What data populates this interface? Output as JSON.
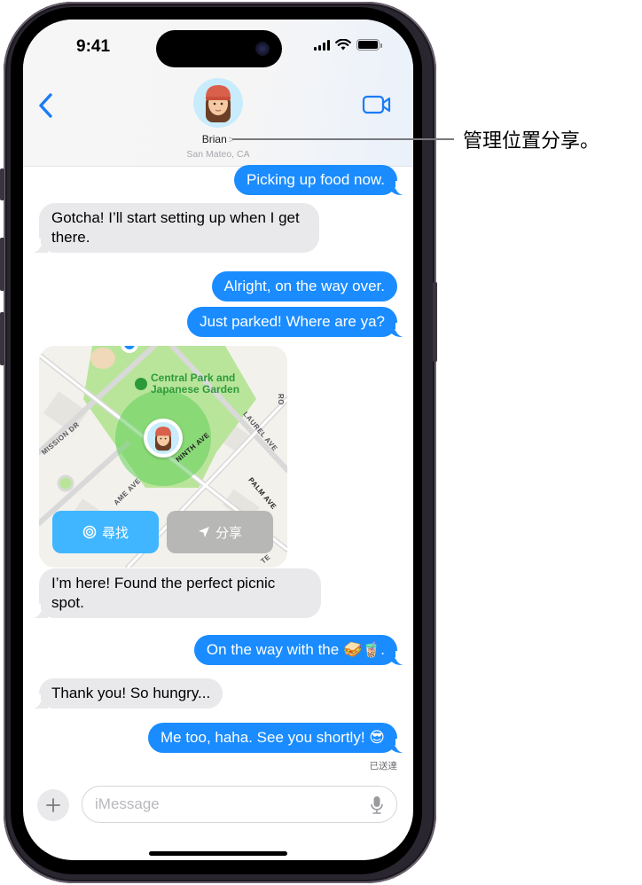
{
  "status_bar": {
    "time": "9:41",
    "icons": [
      "cellular-signal-icon",
      "wifi-icon",
      "battery-icon"
    ]
  },
  "header": {
    "back_icon": "chevron-left-icon",
    "contact_name": "Brian",
    "contact_chevron": ">",
    "contact_location": "San Mateo, CA",
    "video_icon": "video-camera-icon"
  },
  "messages": [
    {
      "direction": "outgoing",
      "text": "Picking up food now."
    },
    {
      "direction": "incoming",
      "text": "Gotcha! I’ll start setting up when I get there."
    },
    {
      "direction": "outgoing",
      "text": "Alright, on the way over."
    },
    {
      "direction": "outgoing",
      "text": "Just parked! Where are ya?"
    },
    {
      "direction": "incoming",
      "type": "location-card"
    },
    {
      "direction": "incoming",
      "text": "I’m here! Found the perfect picnic spot."
    },
    {
      "direction": "outgoing",
      "text": "On the way with the 🥪🧋."
    },
    {
      "direction": "incoming",
      "text": "Thank you! So hungry..."
    },
    {
      "direction": "outgoing",
      "text": "Me too, haha. See you shortly! 😎"
    }
  ],
  "map_card": {
    "park_name_line1": "Central Park and",
    "park_name_line2": "Japanese Garden",
    "street_labels": [
      "MISSION DR",
      "NINTH AVE",
      "LAUREL AVE",
      "PALM AVE",
      "AME AVE",
      "RO",
      "TE"
    ],
    "find_button": "尋找",
    "share_button": "分享",
    "accent_green": "#2d9a3a",
    "find_color": "#3fb6ff"
  },
  "delivered_status": "已送達",
  "composer": {
    "placeholder": "iMessage",
    "value": ""
  },
  "callout": {
    "text": "管理位置分享。"
  },
  "colors": {
    "outgoing_bubble": "#1a8cff",
    "incoming_bubble": "#e9e9eb",
    "ios_blue": "#1a7cf5"
  }
}
